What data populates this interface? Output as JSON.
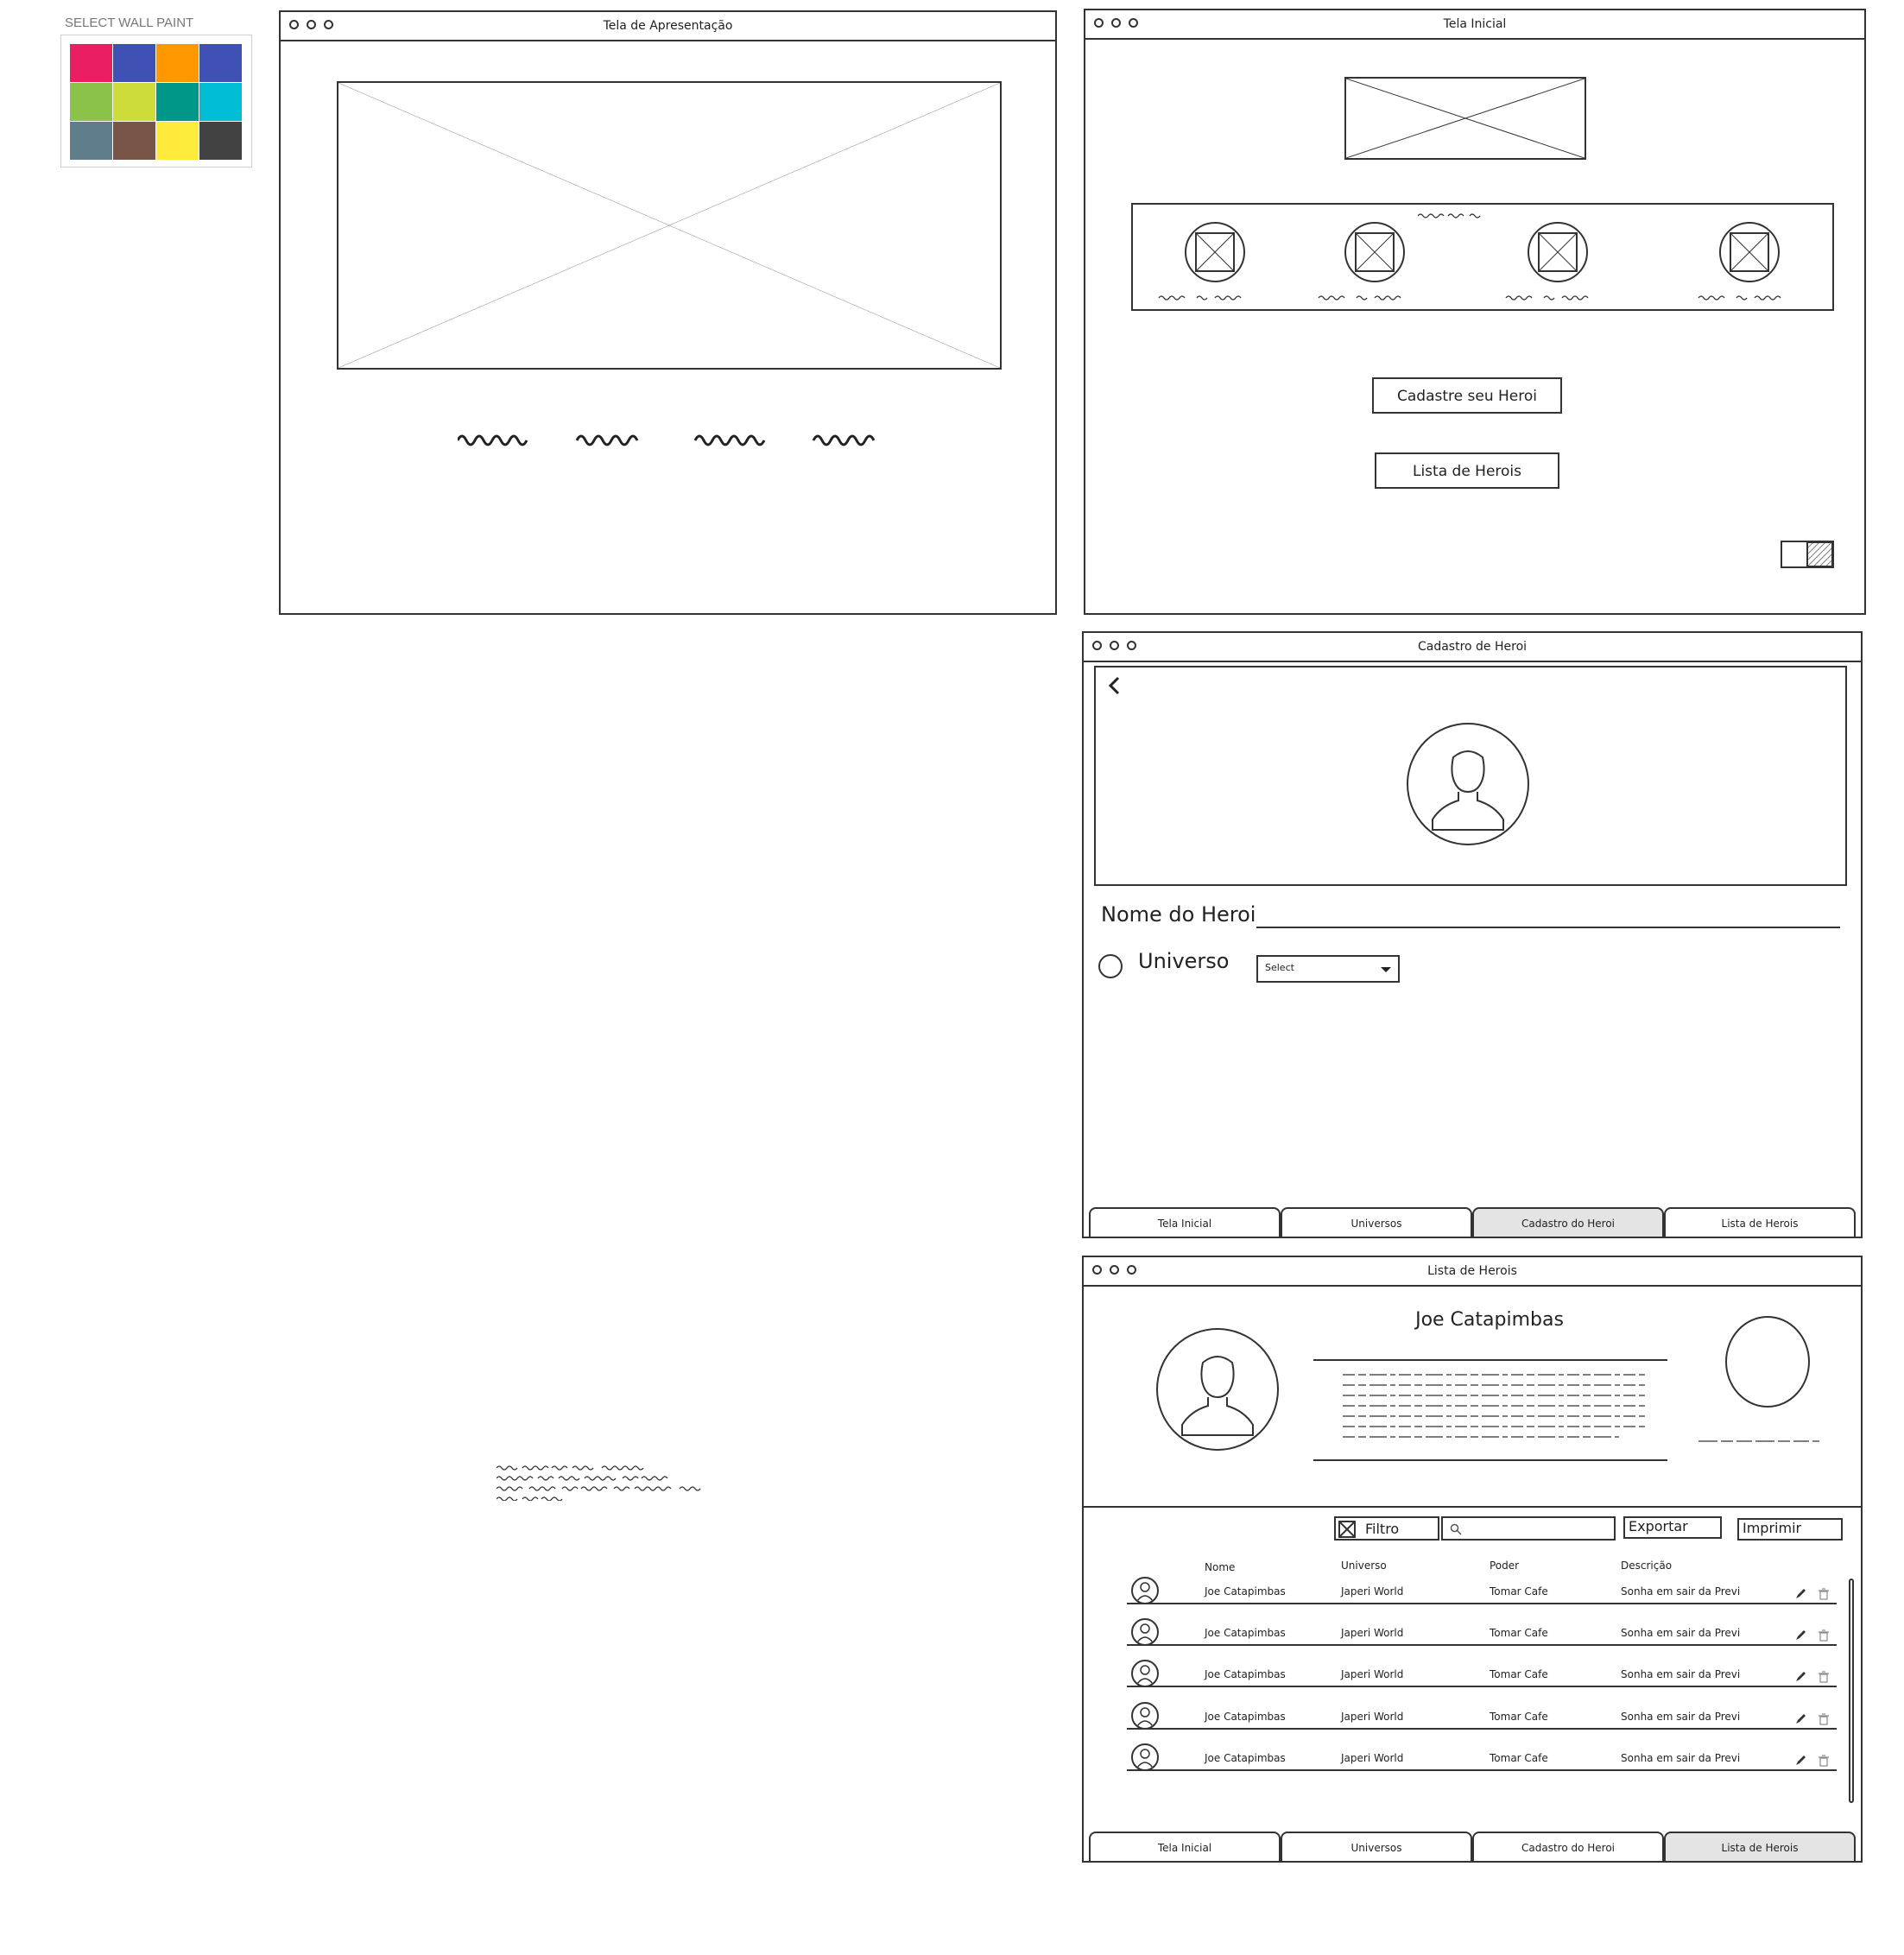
{
  "palette": {
    "title": "SELECT WALL PAINT",
    "colors": [
      "#E91E63",
      "#3F51B5",
      "#FF9800",
      "#3F51B5",
      "#8BC34A",
      "#CDDC39",
      "#009688",
      "#00BCD4",
      "#607D8B",
      "#795548",
      "#FFEB3B",
      "#424242"
    ]
  },
  "apresentacao": {
    "title": "Tela de Apresentação"
  },
  "inicial": {
    "title": "Tela Inicial",
    "cadastre_button": "Cadastre seu Heroi",
    "lista_button": "Lista de Herois"
  },
  "cadastro": {
    "title": "Cadastro de Heroi",
    "nome_label": "Nome do Heroi",
    "universo_label": "Universo",
    "select_value": "Select",
    "tabs": [
      "Tela Inicial",
      "Universos",
      "Cadastro do Heroi",
      "Lista de Herois"
    ],
    "active_tab": 2
  },
  "lista": {
    "title": "Lista de Herois",
    "hero_name": "Joe Catapimbas",
    "toolbar": {
      "filtro": "Filtro",
      "exportar": "Exportar",
      "imprimir": "Imprimir",
      "search_placeholder": ""
    },
    "columns": [
      "Nome",
      "Universo",
      "Poder",
      "Descrição"
    ],
    "rows": [
      {
        "nome": "Joe Catapimbas",
        "universo": "Japeri World",
        "poder": "Tomar Cafe",
        "descricao": "Sonha em sair da Previ"
      },
      {
        "nome": "Joe Catapimbas",
        "universo": "Japeri World",
        "poder": "Tomar Cafe",
        "descricao": "Sonha em sair da Previ"
      },
      {
        "nome": "Joe Catapimbas",
        "universo": "Japeri World",
        "poder": "Tomar Cafe",
        "descricao": "Sonha em sair da Previ"
      },
      {
        "nome": "Joe Catapimbas",
        "universo": "Japeri World",
        "poder": "Tomar Cafe",
        "descricao": "Sonha em sair da Previ"
      },
      {
        "nome": "Joe Catapimbas",
        "universo": "Japeri World",
        "poder": "Tomar Cafe",
        "descricao": "Sonha em sair da Previ"
      }
    ],
    "tabs": [
      "Tela Inicial",
      "Universos",
      "Cadastro do Heroi",
      "Lista de Herois"
    ],
    "active_tab": 3
  }
}
